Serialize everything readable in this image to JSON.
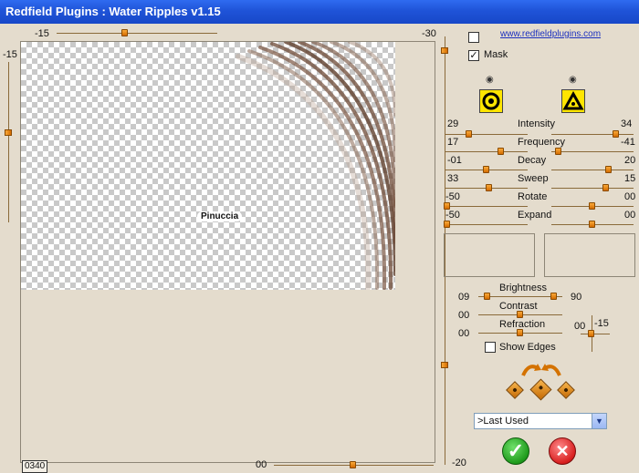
{
  "title": "Redfield Plugins : Water Ripples v1.15",
  "link": "www.redfieldplugins.com",
  "mask_label": "Mask",
  "mask_checked": true,
  "preview": {
    "watermark": "Pinuccia",
    "counter": "0340",
    "top_slider_value": "-15",
    "top_right_value": "-30",
    "left_slider_value": "-15",
    "bottom_slider_value": "00",
    "bottom_right_value": "-20"
  },
  "params": [
    {
      "label": "Intensity",
      "left": "29",
      "right": "34"
    },
    {
      "label": "Frequency",
      "left": "17",
      "right": "-41"
    },
    {
      "label": "Decay",
      "left": "-01",
      "right": "20"
    },
    {
      "label": "Sweep",
      "left": "33",
      "right": "15"
    },
    {
      "label": "Rotate",
      "left": "-50",
      "right": "00"
    },
    {
      "label": "Expand",
      "left": "-50",
      "right": "00"
    }
  ],
  "lighting": {
    "brightness_label": "Brightness",
    "brightness_left": "09",
    "brightness_right": "90",
    "contrast_label": "Contrast",
    "contrast_value": "00",
    "refraction_label": "Refraction",
    "refraction_value": "00",
    "light_x": "00",
    "light_y": "-15",
    "show_edges_label": "Show Edges",
    "show_edges_checked": false
  },
  "preset": {
    "selected": ">Last Used"
  },
  "colors": {
    "accent": "#e08a10",
    "title_bg": "#1f53d8",
    "panel_bg": "#e4dccd"
  }
}
